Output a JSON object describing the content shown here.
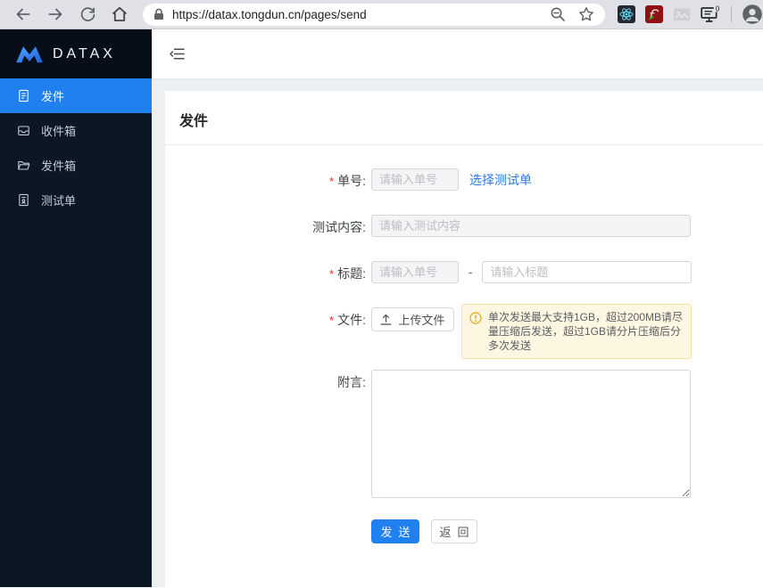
{
  "browser": {
    "url": "https://datax.tongdun.cn/pages/send",
    "icons": [
      "back",
      "forward",
      "reload",
      "home",
      "lock",
      "zoom-out",
      "bookmark-star",
      "react-extension",
      "flash-extension",
      "disabled-extension",
      "screen-capture-extension",
      "profile-avatar"
    ]
  },
  "sidebar": {
    "logo_text": "DATAX",
    "items": [
      {
        "label": "发件",
        "icon": "send-file-icon",
        "active": true
      },
      {
        "label": "收件箱",
        "icon": "inbox-icon",
        "active": false
      },
      {
        "label": "发件箱",
        "icon": "outbox-folder-icon",
        "active": false
      },
      {
        "label": "测试单",
        "icon": "test-order-icon",
        "active": false
      }
    ]
  },
  "page": {
    "title": "发件"
  },
  "form": {
    "required_marker": "*",
    "order": {
      "label": "单号:",
      "placeholder": "请输入单号",
      "link_label": "选择测试单"
    },
    "test_content": {
      "label": "测试内容:",
      "placeholder": "请输入测试内容"
    },
    "title": {
      "label": "标题:",
      "placeholder_left": "请输入单号",
      "separator": "-",
      "placeholder_right": "请输入标题"
    },
    "file": {
      "label": "文件:",
      "upload_label": "上传文件",
      "warning_text": "单次发送最大支持1GB，超过200MB请尽量压缩后发送，超过1GB请分片压缩后分多次发送"
    },
    "note": {
      "label": "附言:"
    },
    "actions": {
      "send_label": "发送",
      "back_label": "返回"
    }
  },
  "colors": {
    "accent_blue": "#2080f0",
    "link_blue": "#2d7ae4",
    "sidebar_bg": "#0c1725",
    "sidebar_logo_bg": "#060e1a",
    "required_red": "#f5222d",
    "warning_bg": "#fdf6e1",
    "warning_border": "#f1e1a8",
    "warning_icon_color": "#dfa615"
  }
}
